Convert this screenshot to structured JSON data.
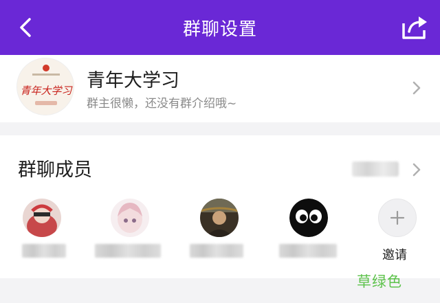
{
  "header": {
    "title": "群聊设置",
    "back_icon": "back-chevron-icon",
    "share_icon": "share-icon",
    "bg_color": "#6a28d6"
  },
  "group": {
    "name": "青年大学习",
    "description": "群主很懒，还没有群介绍哦~",
    "avatar_text": "青年大学习"
  },
  "members": {
    "title": "群聊成员",
    "invite_label": "邀请",
    "invite_icon": "plus-icon",
    "list": [
      {
        "avatar": "avatar-girl-headphones"
      },
      {
        "avatar": "avatar-anime-girl"
      },
      {
        "avatar": "avatar-dark-photo"
      },
      {
        "avatar": "avatar-cartoon-eyes"
      }
    ]
  },
  "watermark": "草绿色"
}
